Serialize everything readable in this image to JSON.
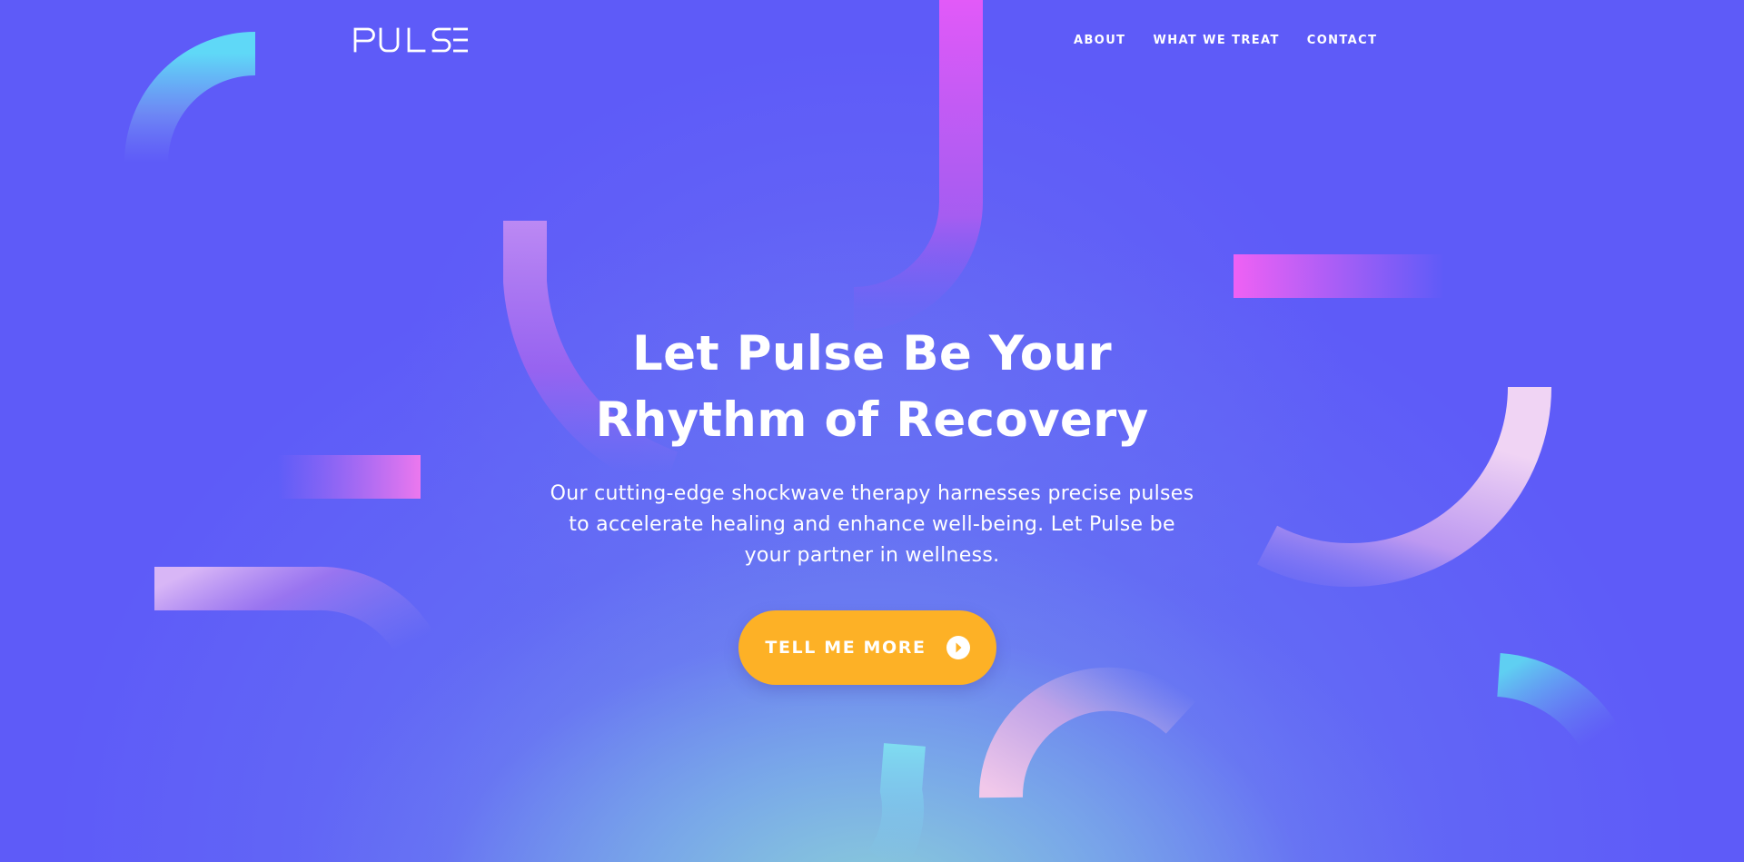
{
  "brand": {
    "logo_text": "PULSE"
  },
  "nav": {
    "items": [
      {
        "label": "ABOUT"
      },
      {
        "label": "WHAT WE TREAT"
      },
      {
        "label": "CONTACT"
      }
    ]
  },
  "hero": {
    "title_line_1": "Let Pulse Be Your",
    "title_line_2": "Rhythm of Recovery",
    "description": "Our cutting-edge shockwave therapy harnesses precise pulses to accelerate healing and enhance well-being. Let Pulse be your partner in wellness.",
    "cta_label": "TELL ME MORE",
    "cta_icon": "arrow-circle-icon"
  },
  "colors": {
    "background": "#5e5bf8",
    "cta": "#fdb126",
    "text": "#ffffff",
    "accent_pink": "#e65df5",
    "accent_cyan": "#5fd8f5"
  }
}
